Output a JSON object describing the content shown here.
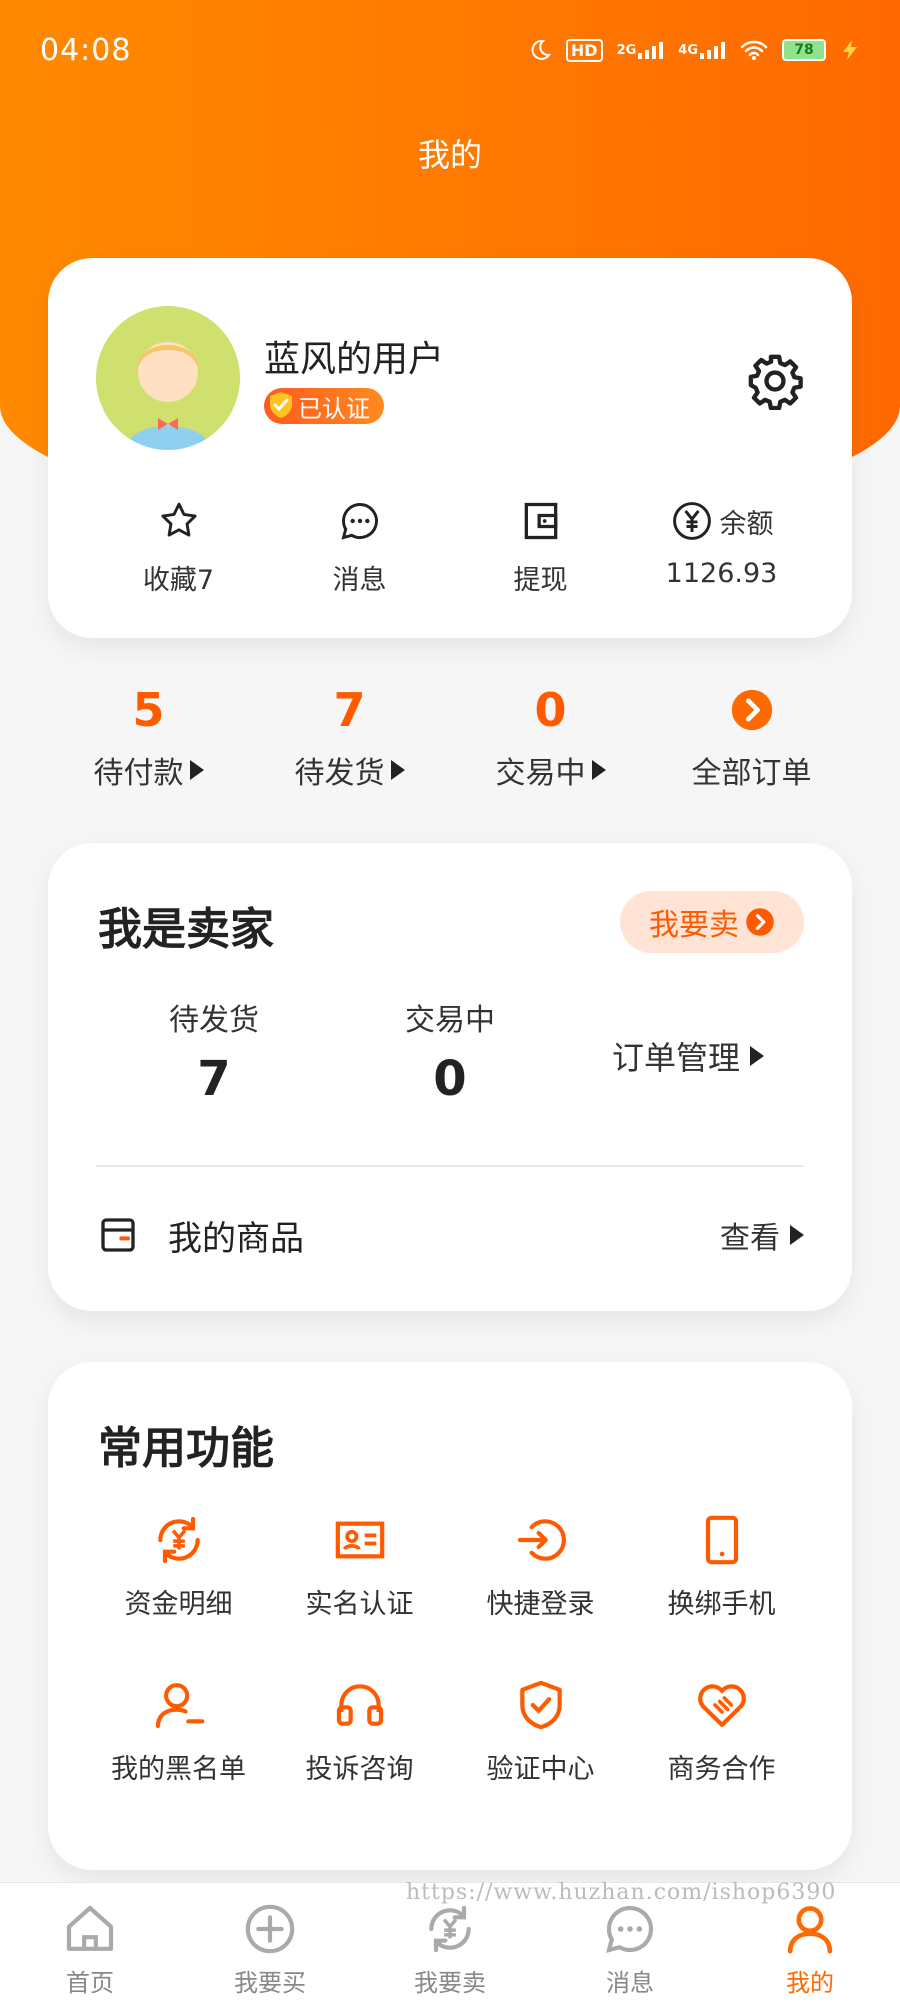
{
  "status_bar": {
    "time": "04:08",
    "hd": "HD",
    "net1": "2G",
    "net2": "4G",
    "battery": "78"
  },
  "header": {
    "title": "我的"
  },
  "profile": {
    "username": "蓝风的用户",
    "verified_label": "已认证",
    "quick": [
      {
        "label": "收藏7"
      },
      {
        "label": "消息"
      },
      {
        "label": "提现"
      },
      {
        "label": "1126.93",
        "prefix": "余额"
      }
    ]
  },
  "orders": [
    {
      "count": "5",
      "label": "待付款"
    },
    {
      "count": "7",
      "label": "待发货"
    },
    {
      "count": "0",
      "label": "交易中"
    },
    {
      "label": "全部订单"
    }
  ],
  "seller": {
    "title": "我是卖家",
    "sell_button": "我要卖",
    "stats": [
      {
        "label": "待发货",
        "value": "7"
      },
      {
        "label": "交易中",
        "value": "0"
      }
    ],
    "order_management": "订单管理",
    "goods_label": "我的商品",
    "view_label": "查看"
  },
  "functions": {
    "title": "常用功能",
    "items": [
      {
        "label": "资金明细",
        "icon": "fund-cycle-icon"
      },
      {
        "label": "实名认证",
        "icon": "id-card-icon"
      },
      {
        "label": "快捷登录",
        "icon": "login-icon"
      },
      {
        "label": "换绑手机",
        "icon": "phone-icon"
      },
      {
        "label": "我的黑名单",
        "icon": "blacklist-user-icon"
      },
      {
        "label": "投诉咨询",
        "icon": "headset-icon"
      },
      {
        "label": "验证中心",
        "icon": "shield-check-icon"
      },
      {
        "label": "商务合作",
        "icon": "handshake-heart-icon"
      }
    ]
  },
  "tabbar": {
    "items": [
      {
        "label": "首页",
        "active": false
      },
      {
        "label": "我要买",
        "active": false
      },
      {
        "label": "我要卖",
        "active": false
      },
      {
        "label": "消息",
        "active": false
      },
      {
        "label": "我的",
        "active": true
      }
    ]
  },
  "watermark": "https://www.huzhan.com/ishop6390",
  "colors": {
    "accent": "#ff6a00",
    "hero_start": "#ff8a00",
    "hero_end": "#ff6a00",
    "tab_inactive": "#888888"
  }
}
